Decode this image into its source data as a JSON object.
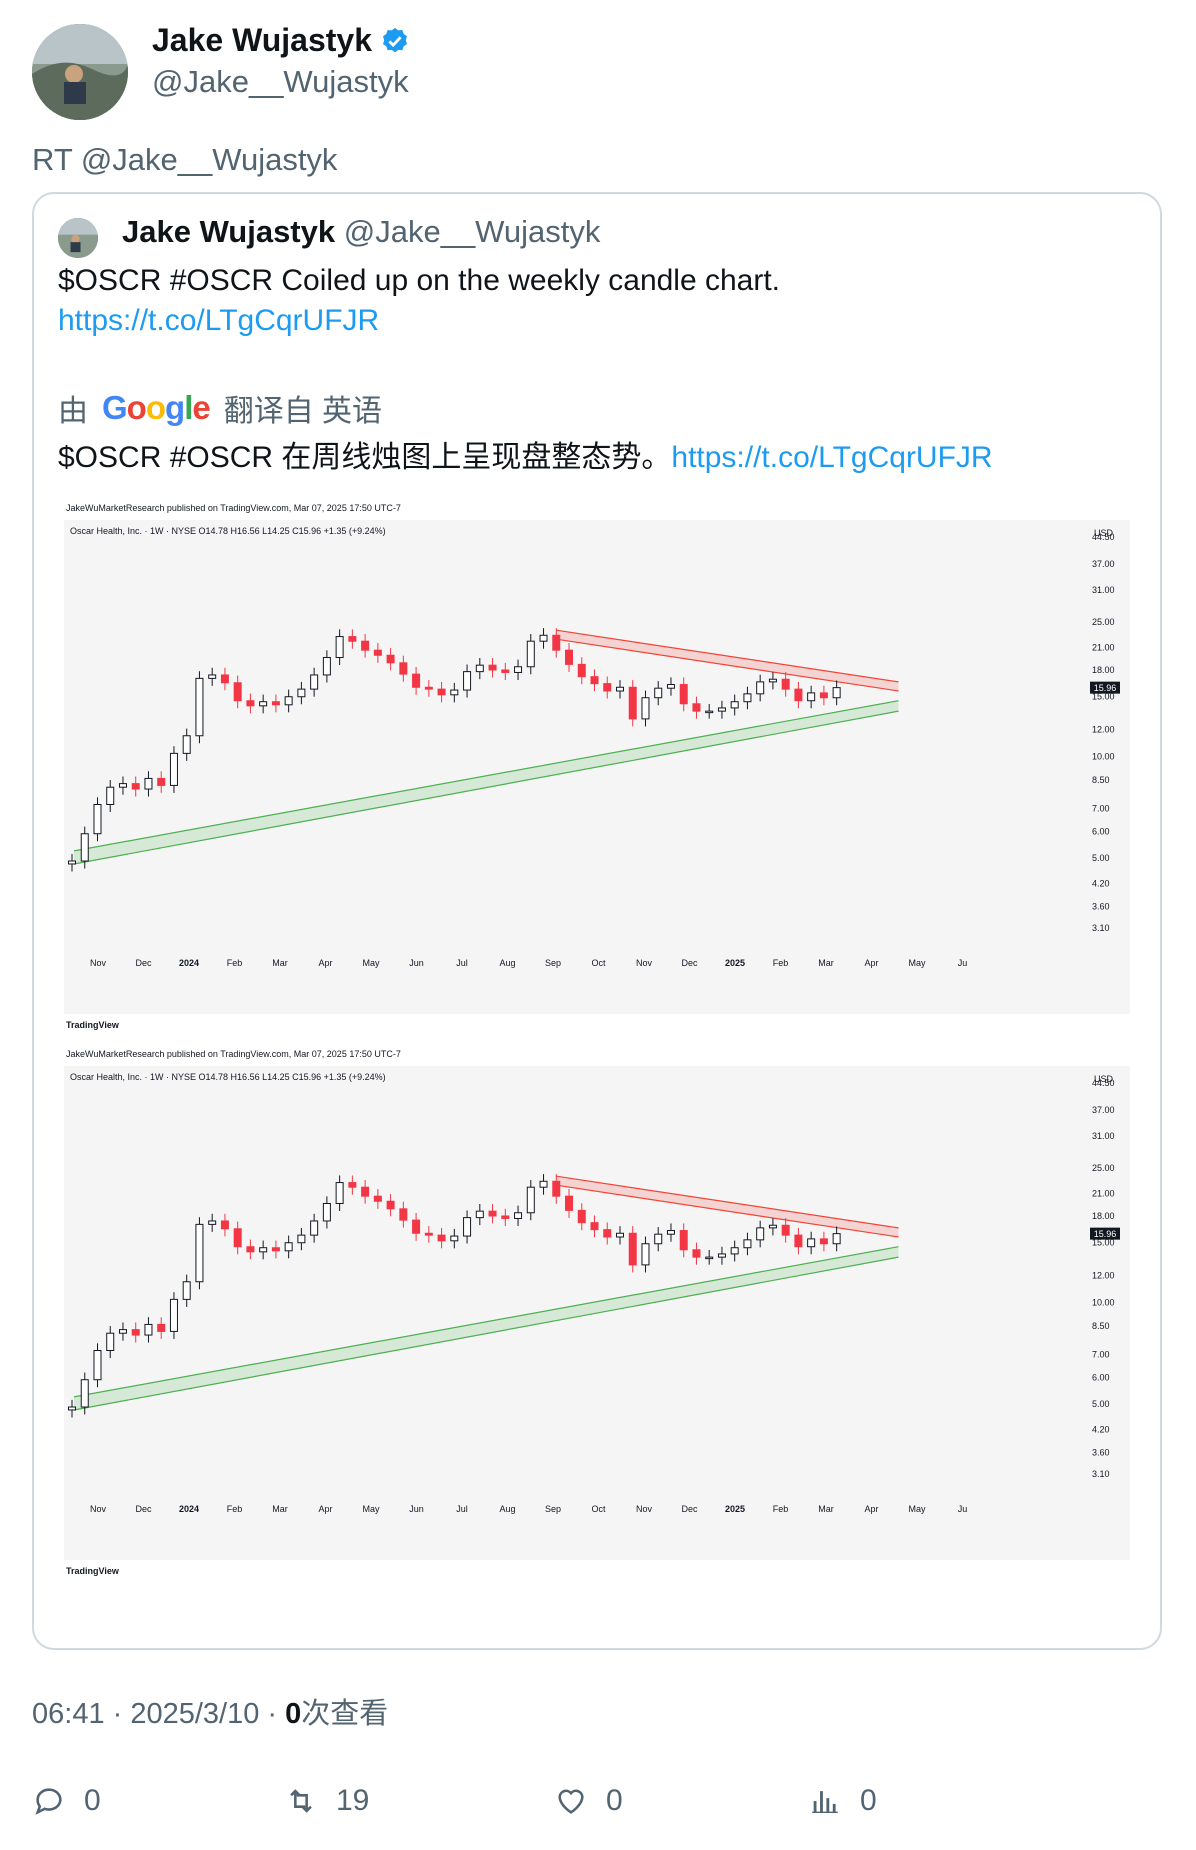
{
  "tweet": {
    "author_name": "Jake Wujastyk",
    "author_handle": "@Jake__Wujastyk",
    "retweet_line": "RT @Jake__Wujastyk",
    "timestamp": "06:41 · 2025/3/10 · ",
    "views_count": "0",
    "views_label": "次查看"
  },
  "quoted": {
    "author_name": "Jake Wujastyk",
    "author_handle": "@Jake__Wujastyk",
    "text": "$OSCR #OSCR Coiled up on the weekly candle chart.",
    "link": "https://t.co/LTgCqrUFJR",
    "translated_by_prefix": "由",
    "translated_by_brand": "Google",
    "translated_by_suffix": "翻译自 英语",
    "translated_text": "$OSCR #OSCR 在周线烛图上呈现盘整态势。",
    "translated_link": "https://t.co/LTgCqrUFJR"
  },
  "actions": {
    "replies": "0",
    "retweets": "19",
    "likes": "0",
    "views": "0"
  },
  "chart_data": [
    {
      "type": "candlestick",
      "header": "JakeWuMarketResearch published on TradingView.com, Mar 07, 2025 17:50 UTC-7",
      "legend": "Oscar Health, Inc. · 1W · NYSE  O14.78  H16.56  L14.25  C15.96  +1.35 (+9.24%)",
      "currency": "USD",
      "last_price": "15.96",
      "y_scale": "log",
      "y_ticks": [
        "44.50",
        "37.00",
        "31.00",
        "25.00",
        "21.00",
        "18.00",
        "15.00",
        "12.00",
        "10.00",
        "8.50",
        "7.00",
        "6.00",
        "5.00",
        "4.20",
        "3.60",
        "3.10"
      ],
      "x_ticks": [
        "Nov",
        "Dec",
        "2024",
        "Feb",
        "Mar",
        "Apr",
        "May",
        "Jun",
        "Jul",
        "Aug",
        "Sep",
        "Oct",
        "Nov",
        "Dec",
        "2025",
        "Feb",
        "Mar",
        "Apr",
        "May",
        "Ju"
      ],
      "closes": [
        4.9,
        5.9,
        7.2,
        8.1,
        8.3,
        8.0,
        8.6,
        8.2,
        10.2,
        11.5,
        17.0,
        17.4,
        16.5,
        14.6,
        14.1,
        14.5,
        14.2,
        15.0,
        15.8,
        17.4,
        19.6,
        22.6,
        21.9,
        20.6,
        19.9,
        18.9,
        17.5,
        16.0,
        15.8,
        15.2,
        15.7,
        17.8,
        18.6,
        18.0,
        17.7,
        18.4,
        21.9,
        22.8,
        20.6,
        18.7,
        17.2,
        16.4,
        15.6,
        16.0,
        12.9,
        14.9,
        15.9,
        16.3,
        14.3,
        13.6,
        13.6,
        13.9,
        14.5,
        15.3,
        16.6,
        16.9,
        15.8,
        14.6,
        15.4,
        14.9,
        15.96
      ],
      "footer": "TradingView"
    },
    {
      "type": "candlestick",
      "header": "JakeWuMarketResearch published on TradingView.com, Mar 07, 2025 17:50 UTC-7",
      "legend": "Oscar Health, Inc. · 1W · NYSE  O14.78  H16.56  L14.25  C15.96  +1.35 (+9.24%)",
      "currency": "USD",
      "last_price": "15.96",
      "y_scale": "log",
      "footer": "TradingView"
    }
  ]
}
